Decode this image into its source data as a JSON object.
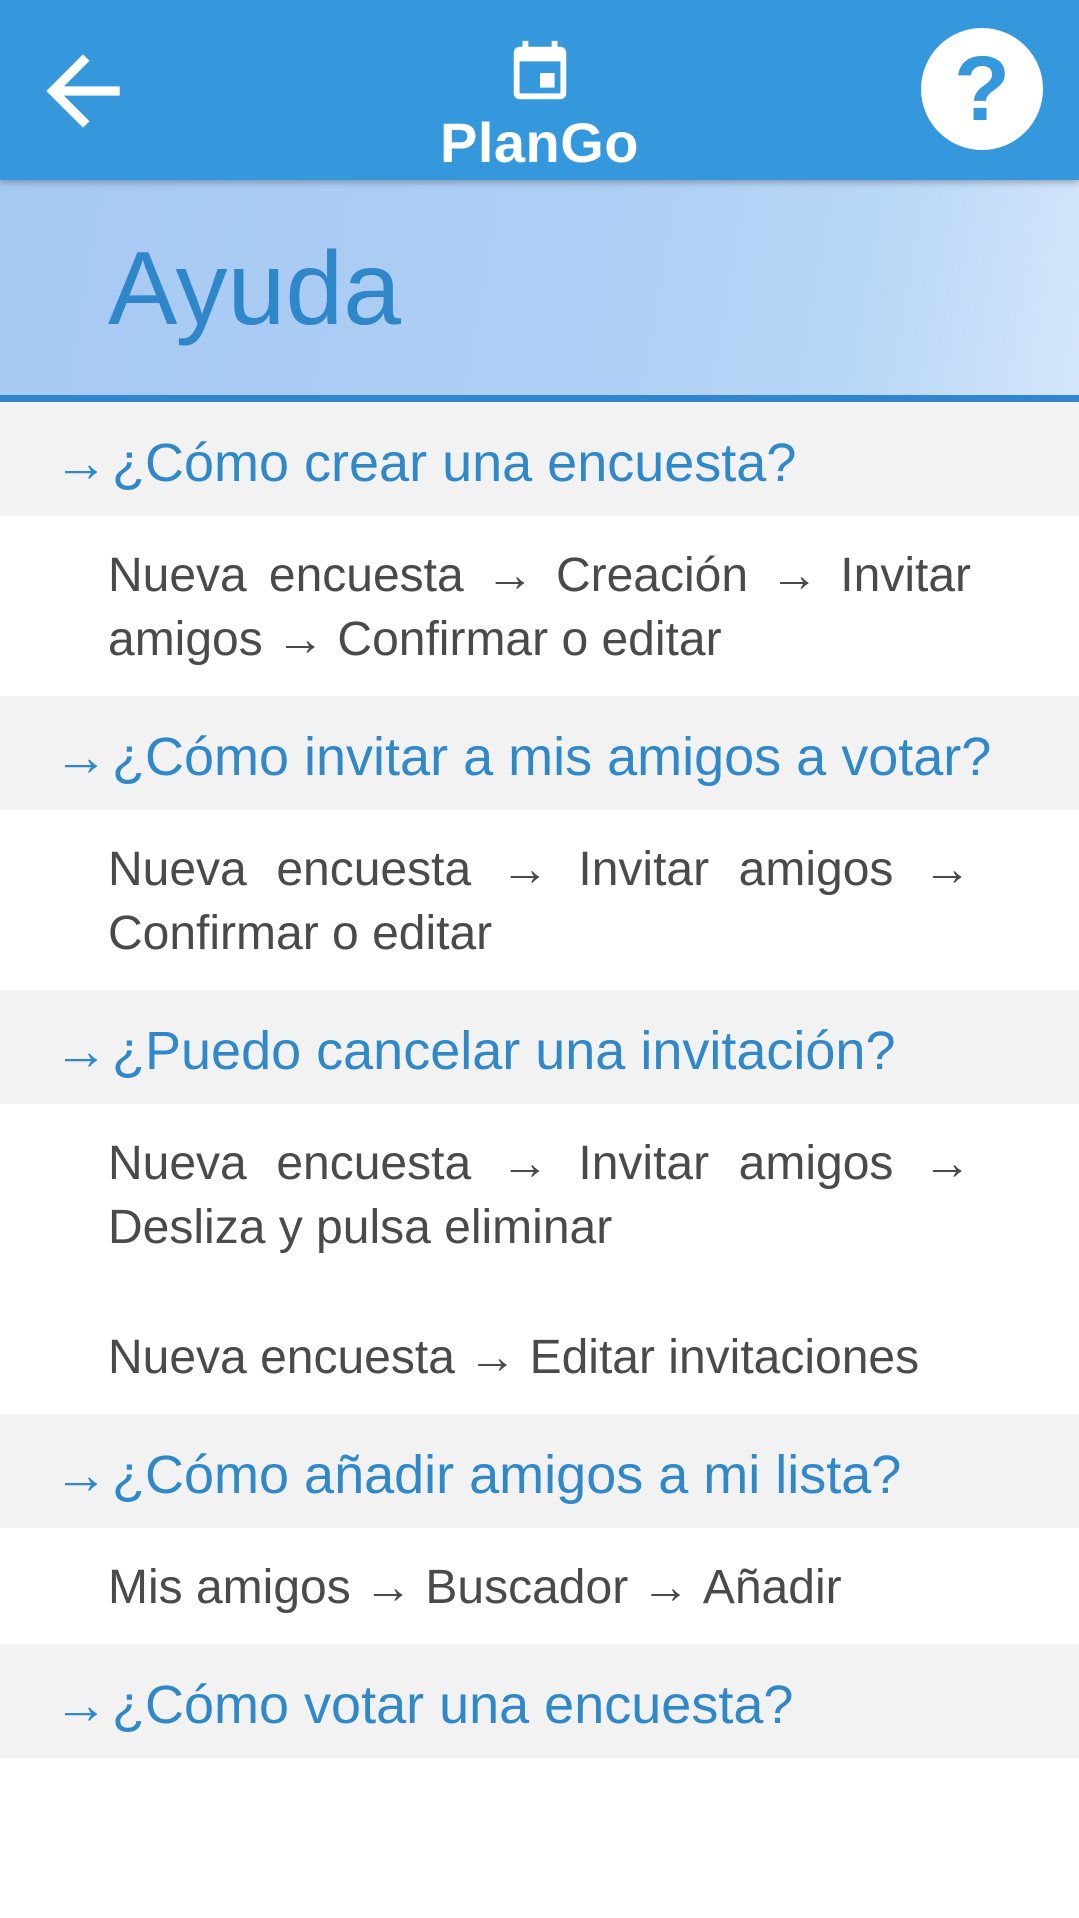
{
  "app": {
    "name": "PlanGo",
    "back_icon": "arrow-left-icon",
    "logo_icon": "calendar-icon",
    "help_label": "?",
    "colors": {
      "primary": "#3598dc",
      "accent_text": "#3088c8",
      "hero_bg": "#aecff5"
    }
  },
  "page": {
    "title": "Ayuda"
  },
  "faq": [
    {
      "question": "¿Cómo crear una encuesta?",
      "answers": [
        [
          "Nueva encuesta",
          "Creación",
          "Invitar amigos",
          "Confirmar o editar"
        ]
      ]
    },
    {
      "question": "¿Cómo invitar a mis amigos a votar?",
      "answers": [
        [
          "Nueva encuesta",
          "Invitar amigos",
          "Confirmar o editar"
        ]
      ]
    },
    {
      "question": "¿Puedo cancelar una invitación?",
      "answers": [
        [
          "Nueva encuesta",
          "Invitar amigos",
          "Desliza y pulsa eliminar"
        ],
        [
          "Nueva encuesta",
          "Editar invitaciones"
        ]
      ]
    },
    {
      "question": "¿Cómo añadir amigos a mi lista?",
      "answers": [
        [
          "Mis amigos",
          "Buscador",
          "Añadir"
        ]
      ]
    },
    {
      "question": "¿Cómo votar una encuesta?",
      "answers": []
    }
  ]
}
